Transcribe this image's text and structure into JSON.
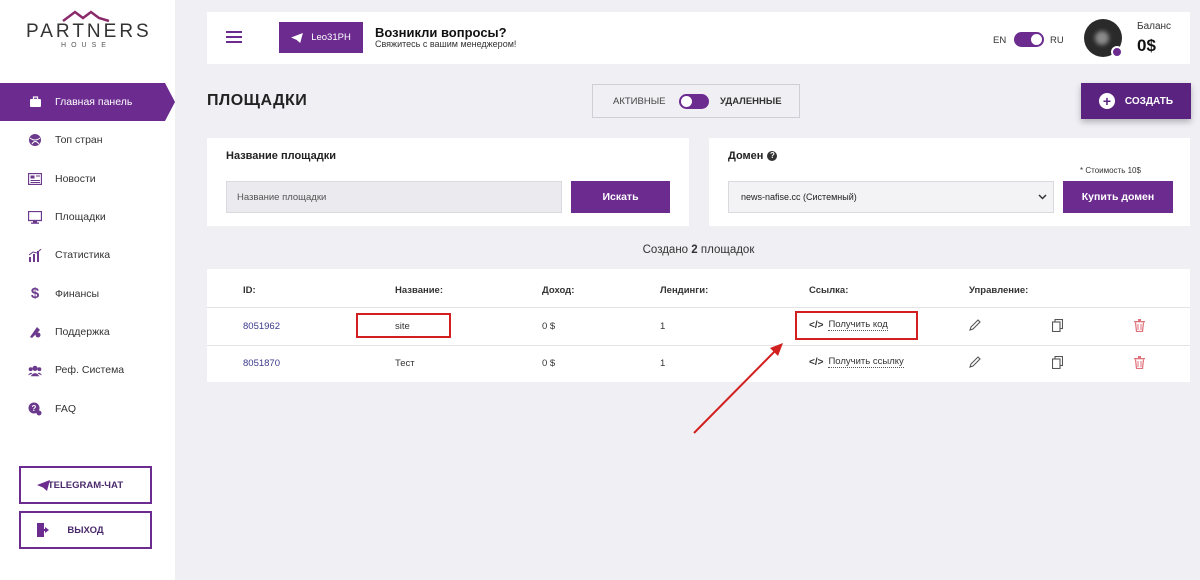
{
  "logo": {
    "main": "PARTNERS",
    "sub": "HOUSE"
  },
  "sidebar": {
    "items": [
      {
        "label": "Главная панель",
        "icon": "briefcase-icon",
        "active": true
      },
      {
        "label": "Топ стран",
        "icon": "globe-icon",
        "active": false
      },
      {
        "label": "Новости",
        "icon": "newspaper-icon",
        "active": false
      },
      {
        "label": "Площадки",
        "icon": "monitor-icon",
        "active": false
      },
      {
        "label": "Статистика",
        "icon": "bar-chart-icon",
        "active": false
      },
      {
        "label": "Финансы",
        "icon": "dollar-icon",
        "active": false
      },
      {
        "label": "Поддержка",
        "icon": "support-icon",
        "active": false
      },
      {
        "label": "Реф. Система",
        "icon": "users-icon",
        "active": false
      },
      {
        "label": "FAQ",
        "icon": "faq-icon",
        "active": false
      }
    ],
    "telegram_label": "TELEGRAM-ЧАТ",
    "exit_label": "ВЫХОД"
  },
  "header": {
    "manager_label": "Leo31PH",
    "question_title": "Возникли вопросы?",
    "question_sub": "Свяжитесь с вашим менеджером!",
    "lang_en": "EN",
    "lang_ru": "RU",
    "balance_label": "Баланс",
    "balance_value": "0$"
  },
  "page": {
    "title": "ПЛОЩАДКИ",
    "filter_active": "АКТИВНЫЕ",
    "filter_deleted": "УДАЛЕННЫЕ",
    "create_label": "СОЗДАТЬ"
  },
  "search_card": {
    "label": "Название площадки",
    "placeholder": "Название площадки",
    "button": "Искать"
  },
  "domain_card": {
    "label": "Домен",
    "price_note": "* Стоимость 10$",
    "selected": "news-nafise.cc (Системный)",
    "button": "Купить домен"
  },
  "created": {
    "prefix": "Создано",
    "count": "2",
    "suffix": "площадок"
  },
  "table": {
    "headers": {
      "id": "ID:",
      "name": "Название:",
      "income": "Доход:",
      "landings": "Лендинги:",
      "link": "Ссылка:",
      "manage": "Управление:"
    },
    "rows": [
      {
        "id": "8051962",
        "name": "site",
        "income": "0 $",
        "landings": "1",
        "link": "Получить код"
      },
      {
        "id": "8051870",
        "name": "Тест",
        "income": "0 $",
        "landings": "1",
        "link": "Получить ссылку"
      }
    ]
  },
  "colors": {
    "accent": "#6b2b8f",
    "annotation": "#d21f1f",
    "background": "#efeff4"
  }
}
